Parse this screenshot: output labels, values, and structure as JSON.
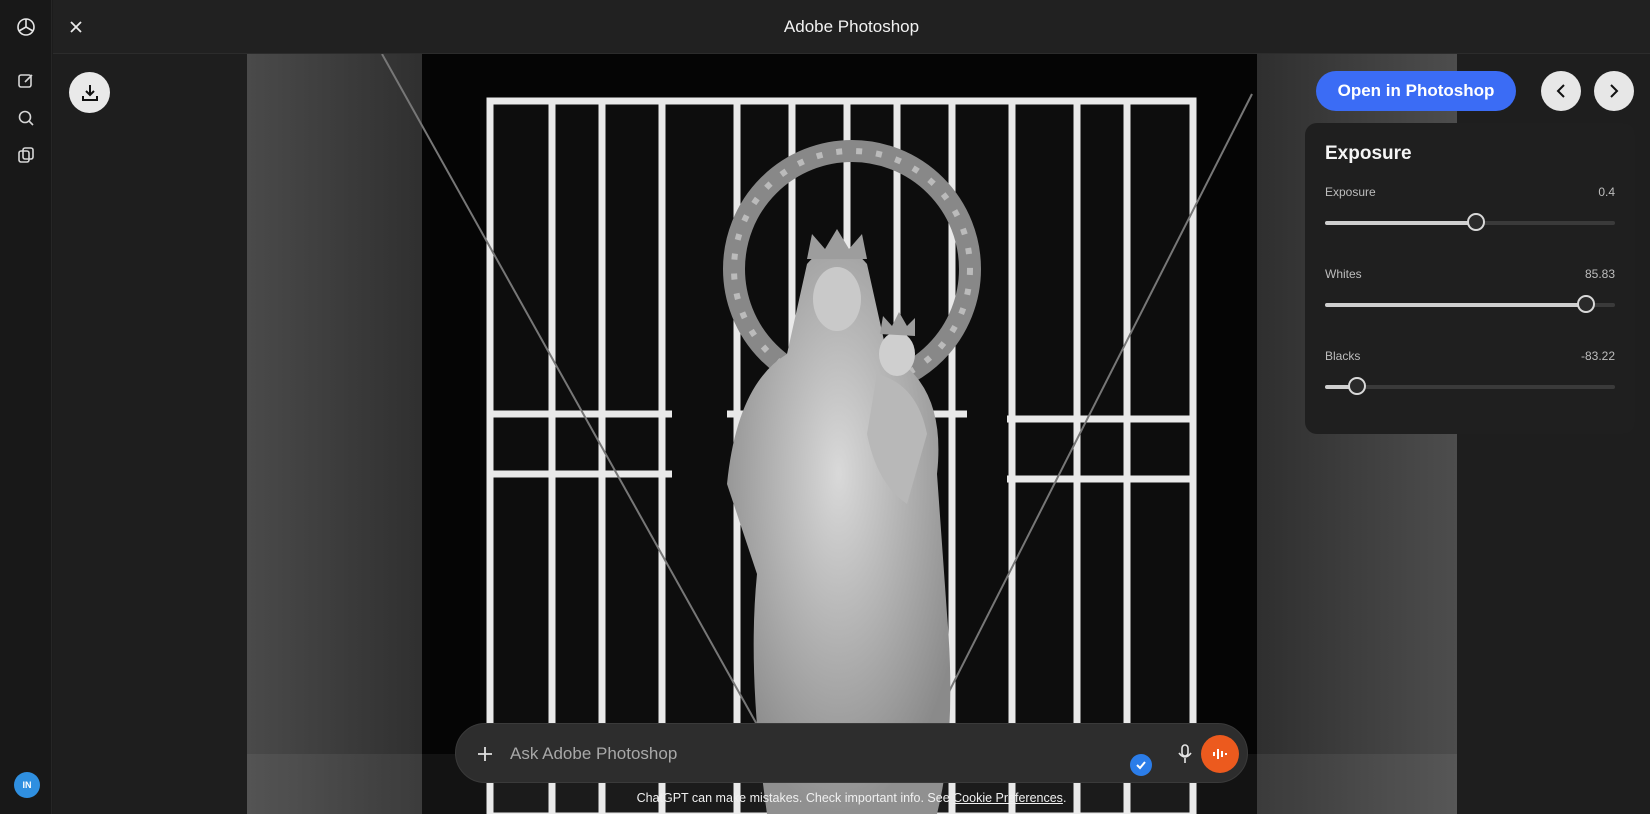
{
  "header": {
    "title": "Adobe Photoshop"
  },
  "rail": {
    "icons": [
      "openai-logo-icon",
      "new-chat-icon",
      "search-icon",
      "library-icon"
    ],
    "avatar_initials": "IN"
  },
  "toolbar": {
    "open_label": "Open in Photoshop"
  },
  "panel": {
    "title": "Exposure",
    "sliders": [
      {
        "label": "Exposure",
        "value": "0.4",
        "level": 0.52
      },
      {
        "label": "Whites",
        "value": "85.83",
        "level": 0.9
      },
      {
        "label": "Blacks",
        "value": "-83.22",
        "level": 0.11
      }
    ]
  },
  "composer": {
    "placeholder": "Ask Adobe Photoshop"
  },
  "footer": {
    "disclaimer": "ChatGPT can make mistakes. Check important info. See",
    "link": "Cookie Preferences",
    "end": "."
  },
  "colors": {
    "accent": "#3b6cf5",
    "voice": "#ec5a1e",
    "badge": "#2b7de9"
  }
}
